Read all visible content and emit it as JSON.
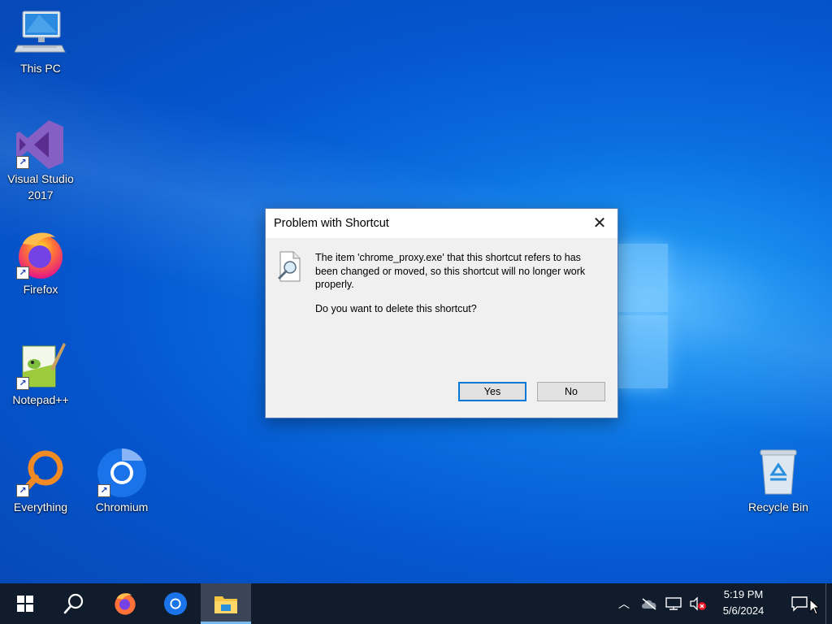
{
  "desktop": {
    "icons": [
      {
        "label": "This PC",
        "icon": "computer-icon"
      },
      {
        "label": "Visual Studio 2017",
        "icon": "visual-studio-icon"
      },
      {
        "label": "Firefox",
        "icon": "firefox-icon"
      },
      {
        "label": "Notepad++",
        "icon": "notepadpp-icon"
      },
      {
        "label": "Everything",
        "icon": "everything-search-icon"
      },
      {
        "label": "Chromium",
        "icon": "chromium-icon"
      },
      {
        "label": "Recycle Bin",
        "icon": "recycle-bin-icon"
      }
    ]
  },
  "dialog": {
    "title": "Problem with Shortcut",
    "message": "The item 'chrome_proxy.exe' that this shortcut refers to has been changed or moved, so this shortcut will no longer work properly.",
    "question": "Do you want to delete this shortcut?",
    "yes_label": "Yes",
    "no_label": "No",
    "close_glyph": "✕",
    "icon": "file-search-icon"
  },
  "taskbar": {
    "items": [
      {
        "name": "start",
        "icon": "windows-start-icon"
      },
      {
        "name": "search",
        "icon": "search-icon"
      },
      {
        "name": "firefox",
        "icon": "firefox-icon"
      },
      {
        "name": "chromium",
        "icon": "chromium-icon"
      },
      {
        "name": "file-explorer",
        "icon": "file-explorer-icon",
        "active": true
      }
    ],
    "tray": {
      "chevron_glyph": "︿",
      "icons": [
        "show-hidden-icons-chevron",
        "onedrive-offline-icon",
        "network-icon",
        "volume-muted-icon"
      ]
    },
    "clock": {
      "time": "5:19 PM",
      "date": "5/6/2024"
    },
    "notifications_icon": "action-center-icon"
  },
  "colors": {
    "accent": "#0078d7",
    "taskbar": "#101c2c",
    "dialog_bg": "#f0f0f0"
  }
}
